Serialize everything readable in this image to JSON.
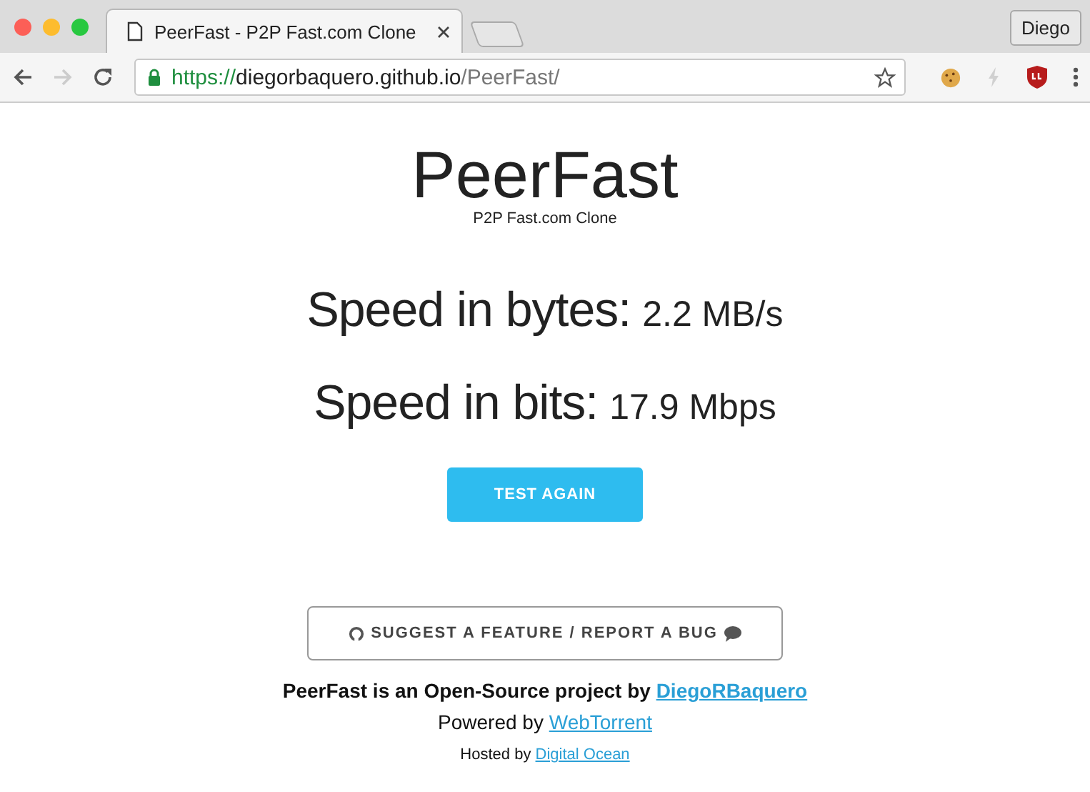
{
  "window": {
    "tab_title": "PeerFast - P2P Fast.com Clone",
    "profile": "Diego"
  },
  "address_bar": {
    "scheme": "https://",
    "host": "diegorbaquero.github.io",
    "path": "/PeerFast/",
    "secure": true
  },
  "page": {
    "title": "PeerFast",
    "subtitle": "P2P Fast.com Clone",
    "readings": [
      {
        "label": "Speed in bytes:",
        "value": "2.2 MB/s"
      },
      {
        "label": "Speed in bits:",
        "value": "17.9 Mbps"
      }
    ],
    "test_button": "TEST AGAIN",
    "feedback_button": "SUGGEST A FEATURE / REPORT A BUG",
    "footer": [
      {
        "kind": "bold",
        "text": "PeerFast is an Open-Source project by ",
        "link": "DiegoRBaquero"
      },
      {
        "kind": "normal",
        "text": "Powered by ",
        "link": "WebTorrent"
      },
      {
        "kind": "small",
        "text": "Hosted by ",
        "link": "Digital Ocean"
      }
    ]
  }
}
